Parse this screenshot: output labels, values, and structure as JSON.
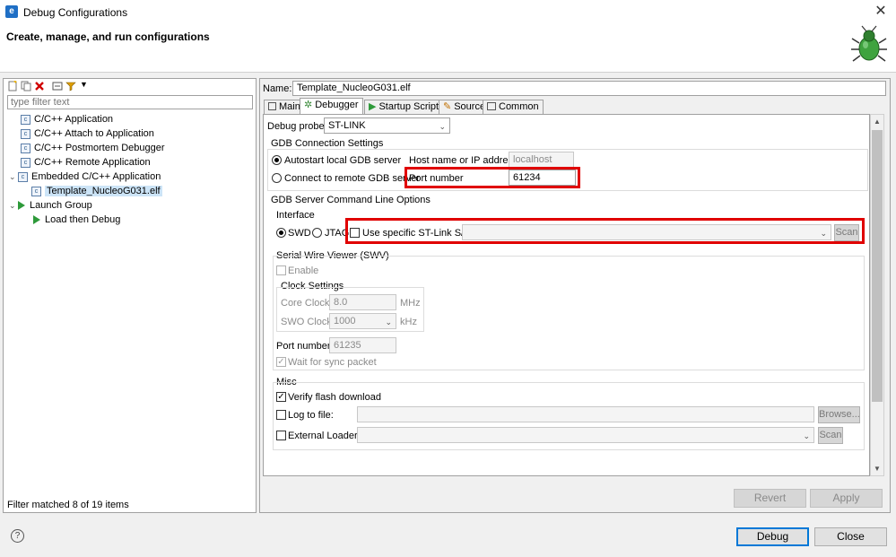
{
  "window": {
    "title": "Debug Configurations",
    "close": "✕"
  },
  "header": {
    "title": "Create, manage, and run configurations"
  },
  "left": {
    "filter_placeholder": "type filter text",
    "tree": [
      {
        "label": "C/C++ Application"
      },
      {
        "label": "C/C++ Attach to Application"
      },
      {
        "label": "C/C++ Postmortem Debugger"
      },
      {
        "label": "C/C++ Remote Application"
      },
      {
        "label": "Embedded C/C++ Application"
      },
      {
        "label": "Template_NucleoG031.elf"
      },
      {
        "label": "Launch Group"
      },
      {
        "label": "Load then Debug"
      }
    ],
    "status": "Filter matched 8 of 19 items"
  },
  "config": {
    "name_label": "Name:",
    "name_value": "Template_NucleoG031.elf",
    "tabs": [
      "Main",
      "Debugger",
      "Startup Scripts",
      "Source",
      "Common"
    ]
  },
  "debugger": {
    "probe_label": "Debug probe",
    "probe_value": "ST-LINK",
    "gdb_conn_title": "GDB Connection Settings",
    "autostart_label": "Autostart local GDB server",
    "host_label": "Host name or IP address",
    "host_value": "localhost",
    "remote_label": "Connect to remote GDB server",
    "port_label": "Port number",
    "port_value": "61234",
    "cmdline_title": "GDB Server Command Line Options",
    "interface_title": "Interface",
    "swd_label": "SWD",
    "jtag_label": "JTAG",
    "stlink_sn_label": "Use specific ST-Link S/N",
    "scan_label": "Scan",
    "swv_title": "Serial Wire Viewer (SWV)",
    "enable_label": "Enable",
    "clock_title": "Clock Settings",
    "core_clock_label": "Core Clock:",
    "core_clock_value": "8.0",
    "core_clock_unit": "MHz",
    "swo_clock_label": "SWO Clock:",
    "swo_clock_value": "1000",
    "swo_clock_unit": "kHz",
    "swv_port_label": "Port number:",
    "swv_port_value": "61235",
    "wait_sync_label": "Wait for sync packet",
    "misc_title": "Misc",
    "verify_label": "Verify flash download",
    "log_label": "Log to file:",
    "browse_label": "Browse...",
    "ext_loader_label": "External Loader:",
    "scan2_label": "Scan"
  },
  "buttons": {
    "revert": "Revert",
    "apply": "Apply",
    "debug": "Debug",
    "close": "Close",
    "help": "?"
  }
}
